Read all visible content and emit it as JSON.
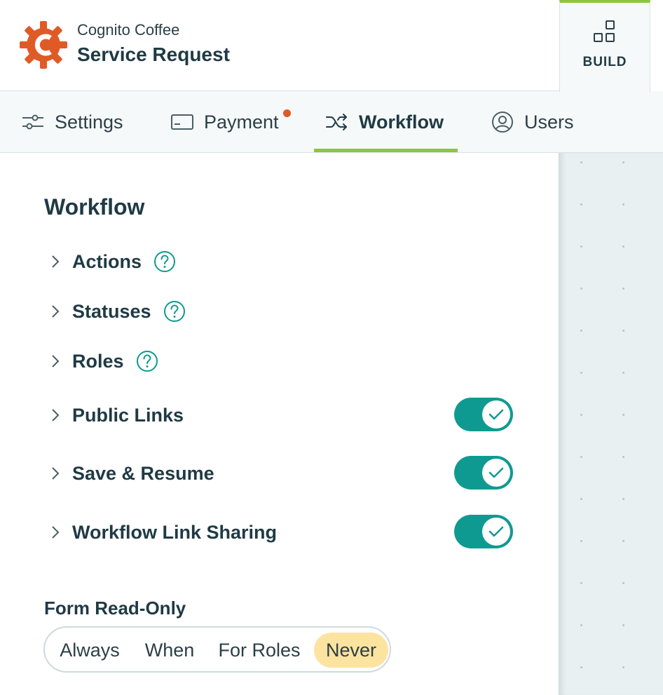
{
  "header": {
    "org_name": "Cognito Coffee",
    "form_name": "Service Request",
    "build_tab_label": "BUILD"
  },
  "colors": {
    "logo_orange": "#e05a26",
    "accent_green": "#8cc63f",
    "toggle_teal": "#0f9a91",
    "selected_segment": "#fde3a0"
  },
  "tabs": [
    {
      "label": "Settings",
      "icon": "sliders-icon"
    },
    {
      "label": "Payment",
      "icon": "credit-card-icon",
      "has_notification": true
    },
    {
      "label": "Workflow",
      "icon": "shuffle-icon",
      "active": true
    },
    {
      "label": "Users",
      "icon": "user-circle-icon"
    }
  ],
  "panel": {
    "title": "Workflow",
    "sections": [
      {
        "label": "Actions",
        "help": true
      },
      {
        "label": "Statuses",
        "help": true
      },
      {
        "label": "Roles",
        "help": true
      },
      {
        "label": "Public Links",
        "toggle": true
      },
      {
        "label": "Save & Resume",
        "toggle": true
      },
      {
        "label": "Workflow Link Sharing",
        "toggle": true
      }
    ],
    "read_only": {
      "label": "Form Read-Only",
      "options": [
        "Always",
        "When",
        "For Roles",
        "Never"
      ],
      "selected": "Never"
    }
  }
}
